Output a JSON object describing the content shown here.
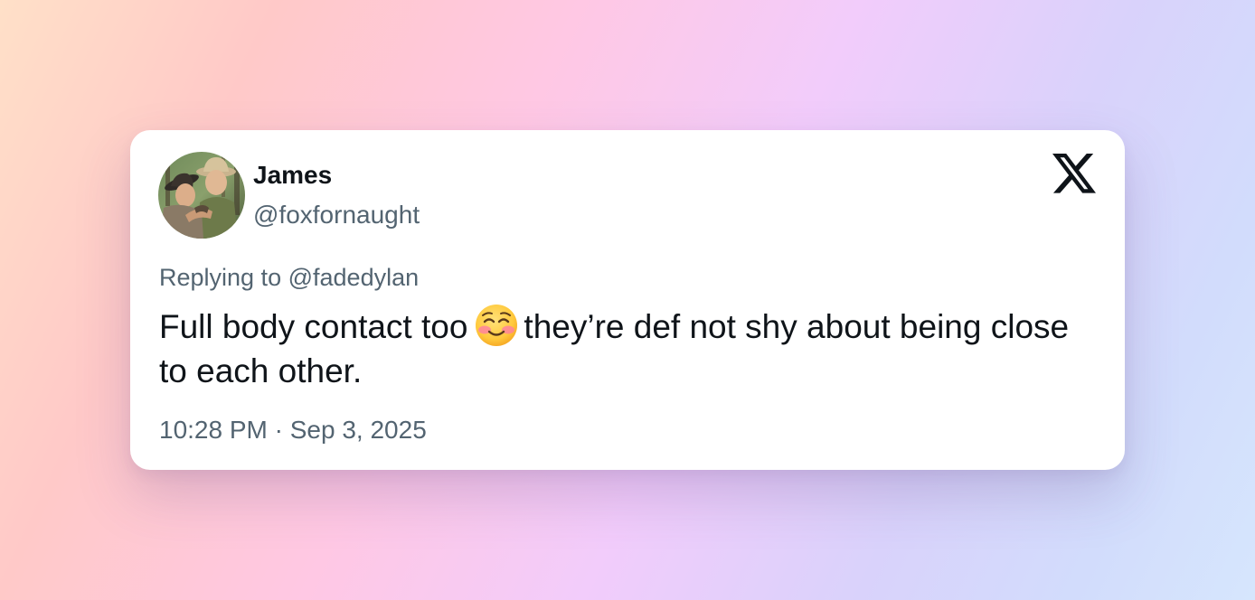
{
  "tweet": {
    "display_name": "James",
    "handle": "@foxfornaught",
    "replying_label": "Replying to",
    "replying_to": "@fadedylan",
    "text_before_emoji": "Full body contact too",
    "emoji": "smiling-face-with-blushing-cheeks-emoji",
    "text_after_emoji": "they’re def not shy about being close to each other.",
    "time": "10:28 PM",
    "date": "Sep 3, 2025",
    "separator": "·"
  },
  "brand": {
    "logo_icon": "x-logo-icon"
  },
  "avatar": {
    "icon": "profile-photo-two-cowboys"
  },
  "colors": {
    "name": "#0f1419",
    "secondary_text": "#536471",
    "card_background": "#ffffff"
  }
}
